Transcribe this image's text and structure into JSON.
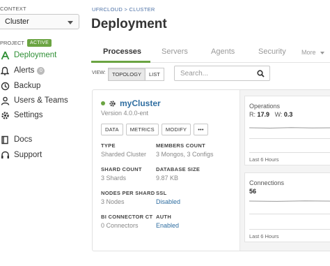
{
  "sidebar": {
    "context_label": "CONTEXT",
    "context_value": "Cluster",
    "project_label": "PROJECT",
    "active_badge": "ACTIVE",
    "items": [
      {
        "label": "Deployment",
        "icon": "deployment-icon"
      },
      {
        "label": "Alerts",
        "icon": "bell-icon",
        "count": "0"
      },
      {
        "label": "Backup",
        "icon": "backup-icon"
      },
      {
        "label": "Users & Teams",
        "icon": "users-icon"
      },
      {
        "label": "Settings",
        "icon": "gear-icon"
      },
      {
        "label": "Docs",
        "icon": "book-icon"
      },
      {
        "label": "Support",
        "icon": "headset-icon"
      }
    ]
  },
  "header": {
    "breadcrumb": "UFRCLOUD > CLUSTER",
    "title": "Deployment"
  },
  "tabs": [
    {
      "label": "Processes",
      "active": true
    },
    {
      "label": "Servers"
    },
    {
      "label": "Agents"
    },
    {
      "label": "Security"
    },
    {
      "label": "More"
    }
  ],
  "toolbar": {
    "view_label": "VIEW:",
    "topology": "TOPOLOGY",
    "list": "LIST",
    "search_placeholder": "Search..."
  },
  "cluster": {
    "name": "myCluster",
    "version": "Version 4.0.0-ent",
    "actions": [
      "DATA",
      "METRICS",
      "MODIFY",
      "•••"
    ],
    "fields": {
      "type_label": "TYPE",
      "type_value": "Sharded Cluster",
      "members_label": "MEMBERS COUNT",
      "members_value": "3 Mongos, 3 Configs",
      "shard_label": "SHARD COUNT",
      "shard_value": "3 Shards",
      "dbsize_label": "DATABASE SIZE",
      "dbsize_value": "9.87 KB",
      "nodes_label": "NODES PER SHARD",
      "nodes_value": "3 Nodes",
      "ssl_label": "SSL",
      "ssl_value": "Disabled",
      "bi_label": "BI CONNECTOR CT",
      "bi_value": "0 Connectors",
      "auth_label": "AUTH",
      "auth_value": "Enabled"
    }
  },
  "metrics": {
    "operations": {
      "title": "Operations",
      "r_label": "R:",
      "r_value": "17.9",
      "w_label": "W:",
      "w_value": "0.3",
      "footer": "Last 6 Hours"
    },
    "connections": {
      "title": "Connections",
      "value": "56",
      "footer": "Last 6 Hours"
    }
  },
  "colors": {
    "accent_green": "#6ba442",
    "link_blue": "#2f6ea1"
  }
}
